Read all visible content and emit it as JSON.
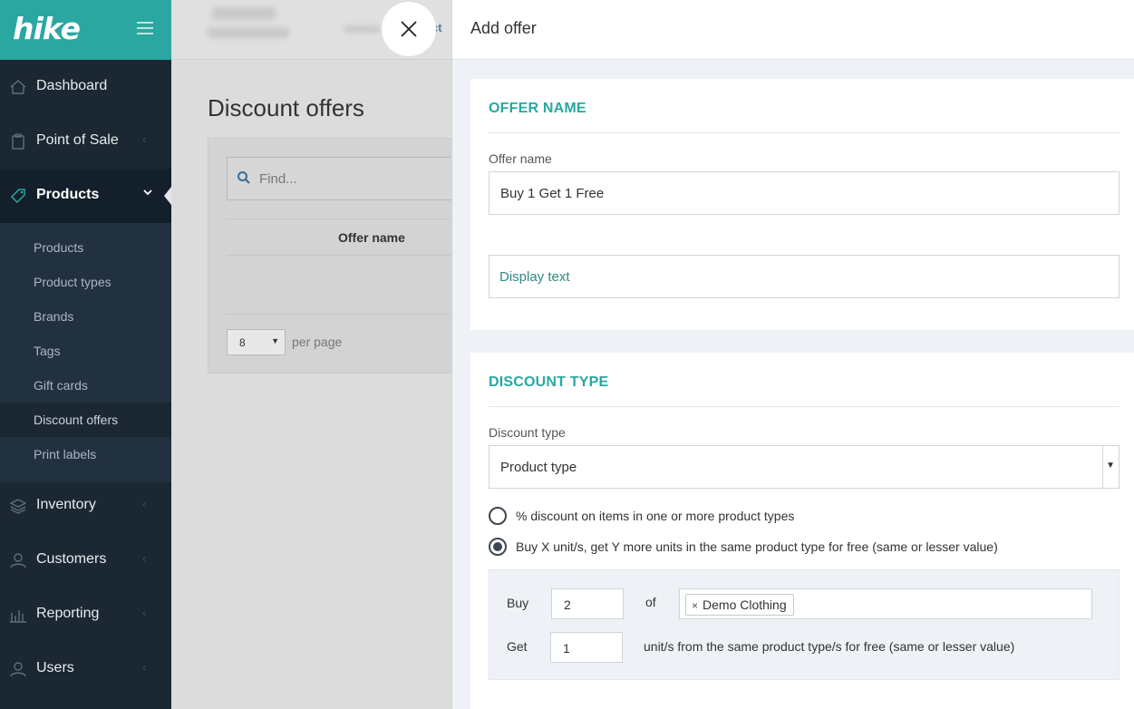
{
  "app": {
    "logo": "hike"
  },
  "sidebar": {
    "items": [
      {
        "label": "Dashboard",
        "icon": "home-icon"
      },
      {
        "label": "Point of Sale",
        "icon": "clipboard-icon"
      },
      {
        "label": "Products",
        "icon": "tag-icon"
      },
      {
        "label": "Inventory",
        "icon": "layers-icon"
      },
      {
        "label": "Customers",
        "icon": "user-icon"
      },
      {
        "label": "Reporting",
        "icon": "bar-chart-icon"
      },
      {
        "label": "Users",
        "icon": "user-icon"
      }
    ],
    "products_sub": [
      "Products",
      "Product types",
      "Brands",
      "Tags",
      "Gift cards",
      "Discount offers",
      "Print labels"
    ],
    "active_item": "Products",
    "active_sub": "Discount offers"
  },
  "background_page": {
    "topbar_link": "ct",
    "title": "Discount offers",
    "search_placeholder": "Find...",
    "column_header": "Offer name",
    "per_page_value": "8",
    "per_page_label": "per page"
  },
  "drawer": {
    "title": "Add offer",
    "offer_section": {
      "heading": "OFFER NAME",
      "offer_name_label": "Offer name",
      "offer_name_value": "Buy 1 Get 1 Free",
      "display_text_placeholder": "Display text"
    },
    "discount_section": {
      "heading": "DISCOUNT TYPE",
      "discount_type_label": "Discount type",
      "discount_type_value": "Product type",
      "options": [
        {
          "label": "% discount on items in one or more product types",
          "checked": false
        },
        {
          "label": "Buy X unit/s, get Y more units in the same product type for free (same or lesser value)",
          "checked": true
        }
      ],
      "rule": {
        "buy_label": "Buy",
        "buy_value": "2",
        "of_label": "of",
        "tag_remove": "×",
        "tag": "Demo Clothing",
        "get_label": "Get",
        "get_value": "1",
        "suffix": "unit/s from the same product type/s for free (same or lesser value)"
      }
    }
  },
  "colors": {
    "brand_teal": "#2aa7a1",
    "sidebar_bg": "#1b2733",
    "heading_teal": "#2aa7a1"
  }
}
